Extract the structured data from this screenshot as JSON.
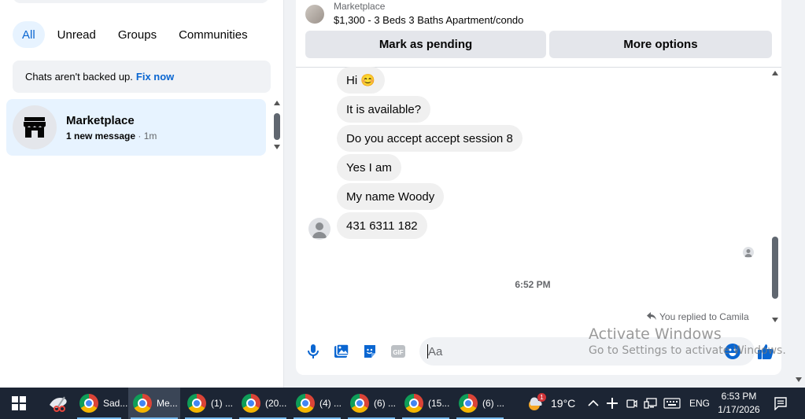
{
  "left": {
    "filters": [
      {
        "label": "All",
        "active": true
      },
      {
        "label": "Unread",
        "active": false
      },
      {
        "label": "Groups",
        "active": false
      },
      {
        "label": "Communities",
        "active": false
      }
    ],
    "backup": {
      "text": "Chats aren't backed up.",
      "link": "Fix now"
    },
    "chat": {
      "title": "Marketplace",
      "unread": "1 new message",
      "time": "· 1m"
    }
  },
  "conversation": {
    "listing": {
      "source": "Marketplace",
      "title": "$1,300 - 3 Beds 3 Baths Apartment/condo"
    },
    "buttons": {
      "pending": "Mark as pending",
      "more": "More options"
    },
    "messages": [
      "Hi 😊",
      "It is available?",
      "Do you accept accept session 8",
      "Yes I am",
      "My name Woody",
      "431 6311 182"
    ],
    "timestamp": "6:52 PM",
    "replied": "You replied to Camila",
    "composer": {
      "placeholder": "Aa"
    },
    "icons": [
      "microphone-icon",
      "photo-icon",
      "sticker-icon",
      "gif-icon",
      "emoji-icon",
      "like-icon"
    ]
  },
  "watermark": {
    "line1": "Activate Windows",
    "line2": "Go to Settings to activate Windows."
  },
  "taskbar": {
    "apps": [
      "Sad...",
      "Me...",
      "(1) ...",
      "(20...",
      "(4) ...",
      "(6) ...",
      "(15...",
      "(6) ..."
    ],
    "weather": {
      "temp": "19°C",
      "badge": "1"
    },
    "language": "ENG",
    "time": "6:53 PM",
    "date": "1/17/2026"
  },
  "colors": {
    "accent": "#0a66d1",
    "taskbar": "#1c2534",
    "bubble": "#f0f0f0"
  }
}
